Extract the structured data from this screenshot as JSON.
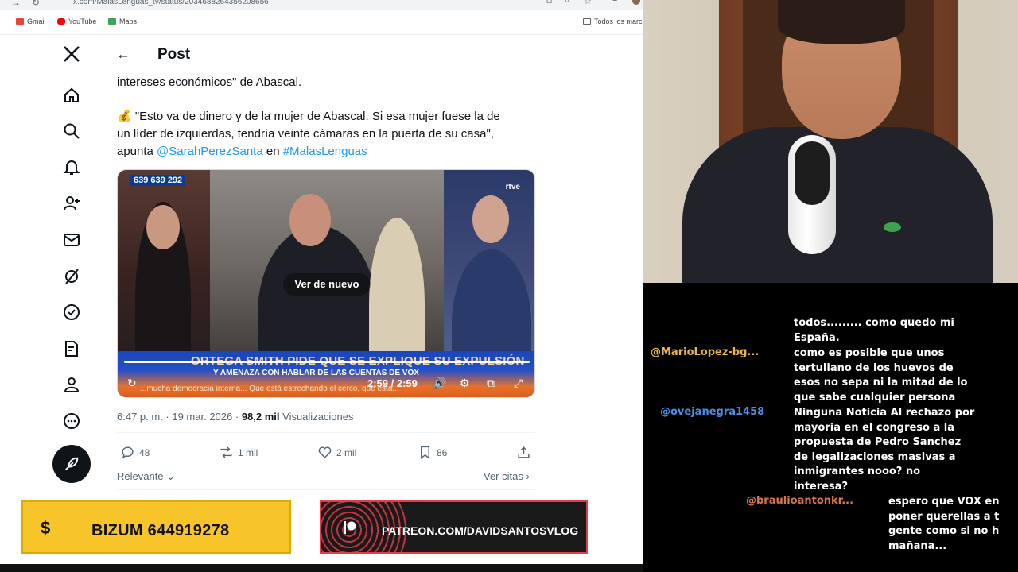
{
  "browser": {
    "url": "x.com/MalasLenguas_tv/status/2034688264356208656",
    "bookmarks": [
      {
        "label": "Gmail",
        "color": "#ea4335"
      },
      {
        "label": "YouTube",
        "color": "#ff0000"
      },
      {
        "label": "Maps",
        "color": "#34a853"
      }
    ],
    "bookmarks_folder": "Todos los marc"
  },
  "header": {
    "title": "Post"
  },
  "tweet": {
    "line1": "intereses económicos\" de Abascal.",
    "line2_emoji": "💰",
    "line2": " \"Esto va de dinero y de la mujer de Abascal. Si esa mujer fuese la de",
    "line3": "un líder de izquierdas, tendría veinte cámaras en la puerta de su casa\",",
    "line4_prefix": "apunta ",
    "mention": "@SarahPerezSanta",
    "line4_mid": " en ",
    "hashtag": "#MalasLenguas"
  },
  "video": {
    "phone": "639 639 292",
    "channel": "rtve",
    "replay_label": "Ver de nuevo",
    "banner_title": "ORTEGA SMITH PIDE QUE SE EXPLIQUE SU EXPULSIÓN",
    "banner_sub": "Y AMENAZA CON HABLAR DE LAS CUENTAS DE VOX",
    "ticker": "...mucha democracia interna... Que está estrechando el cerco, que está...",
    "time": "2:59 / 2:59",
    "progress": 1.0
  },
  "meta": {
    "time": "6:47 p. m. · 19 mar. 2026 · ",
    "views": "98,2 mil",
    "views_label": " Visualizaciones"
  },
  "actions": {
    "replies": "48",
    "reposts": "1 mil",
    "likes": "2 mil",
    "bookmarks": "86"
  },
  "sort": {
    "label": "Relevante",
    "quotes": "Ver citas"
  },
  "overlays": {
    "bizum_symbol": "$",
    "bizum": "BIZUM 644919278",
    "patreon": "PATREON.COM/DAVIDSANTOSVLOG"
  },
  "chat": {
    "messages": [
      {
        "user": "",
        "text": [
          "todos......... como quedo mi",
          "España."
        ]
      },
      {
        "user": "@MarioLopez-bg...",
        "user_color": "#e8b84a",
        "text": [
          "como es posible que unos",
          "tertuliano de los huevos de",
          "esos no sepa ni la mitad de lo",
          "que sabe cualquier persona"
        ]
      },
      {
        "user": "@ovejanegra1458",
        "user_color": "#4a8fe8",
        "text": [
          "Ninguna Noticia Al rechazo por",
          "mayoria en el congreso a la",
          "propuesta de Pedro Sanchez",
          "de legalizaciones masivas a",
          "inmigrantes nooo? no",
          "interesa?"
        ]
      },
      {
        "user": "@braulioantonkr...",
        "user_color": "#d8754a",
        "text": [
          "espero que VOX en",
          "poner querellas a t",
          "gente como si no h",
          "mañana..."
        ]
      }
    ]
  }
}
